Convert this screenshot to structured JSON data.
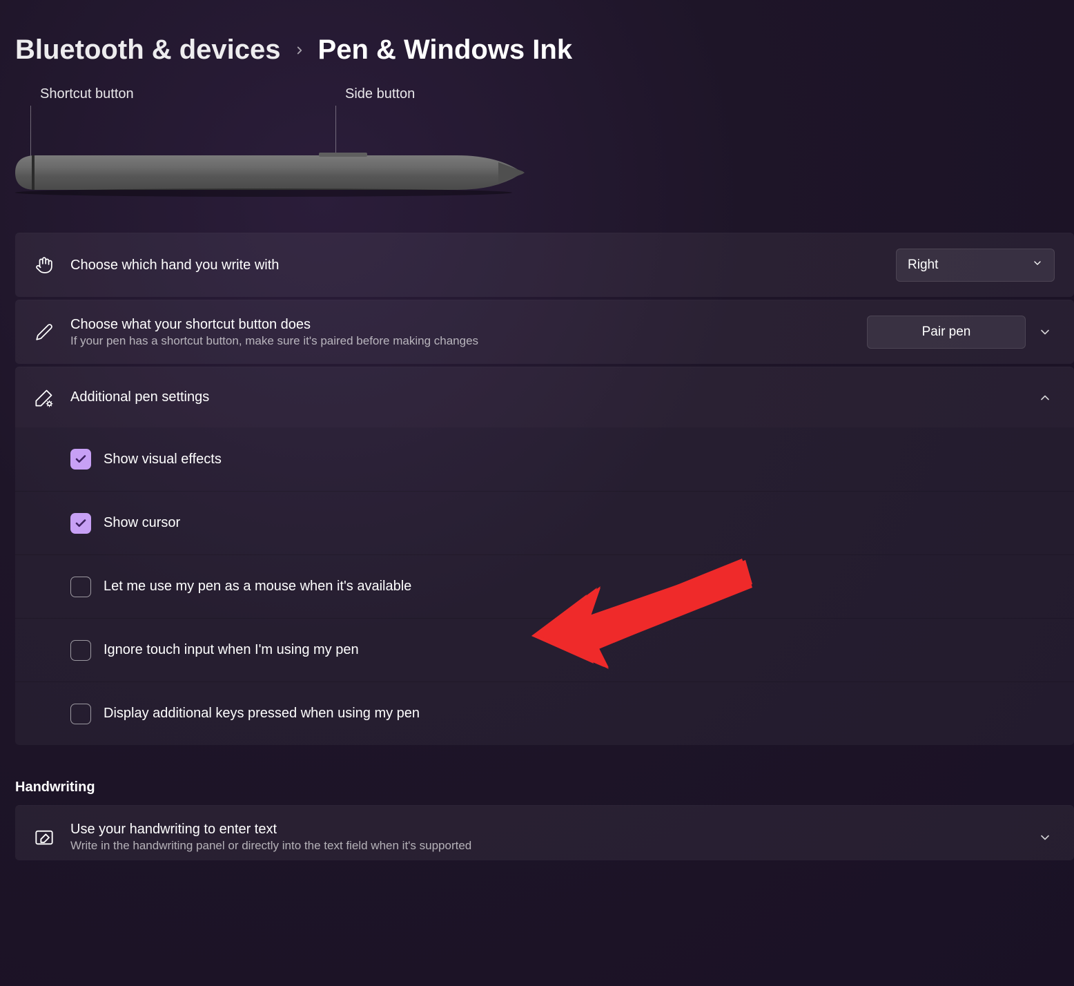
{
  "breadcrumb": {
    "parent": "Bluetooth & devices",
    "current": "Pen & Windows Ink"
  },
  "pen_diagram": {
    "shortcut_label": "Shortcut button",
    "side_label": "Side button"
  },
  "rows": {
    "hand": {
      "title": "Choose which hand you write with",
      "value": "Right"
    },
    "shortcut": {
      "title": "Choose what your shortcut button does",
      "sub": "If your pen has a shortcut button, make sure it's paired before making changes",
      "button": "Pair pen"
    },
    "additional": {
      "title": "Additional pen settings",
      "items": [
        {
          "label": "Show visual effects",
          "checked": true
        },
        {
          "label": "Show cursor",
          "checked": true
        },
        {
          "label": "Let me use my pen as a mouse when it's available",
          "checked": false
        },
        {
          "label": "Ignore touch input when I'm using my pen",
          "checked": false
        },
        {
          "label": "Display additional keys pressed when using my pen",
          "checked": false
        }
      ]
    }
  },
  "handwriting": {
    "heading": "Handwriting",
    "row": {
      "title": "Use your handwriting to enter text",
      "sub": "Write in the handwriting panel or directly into the text field when it's supported"
    }
  }
}
